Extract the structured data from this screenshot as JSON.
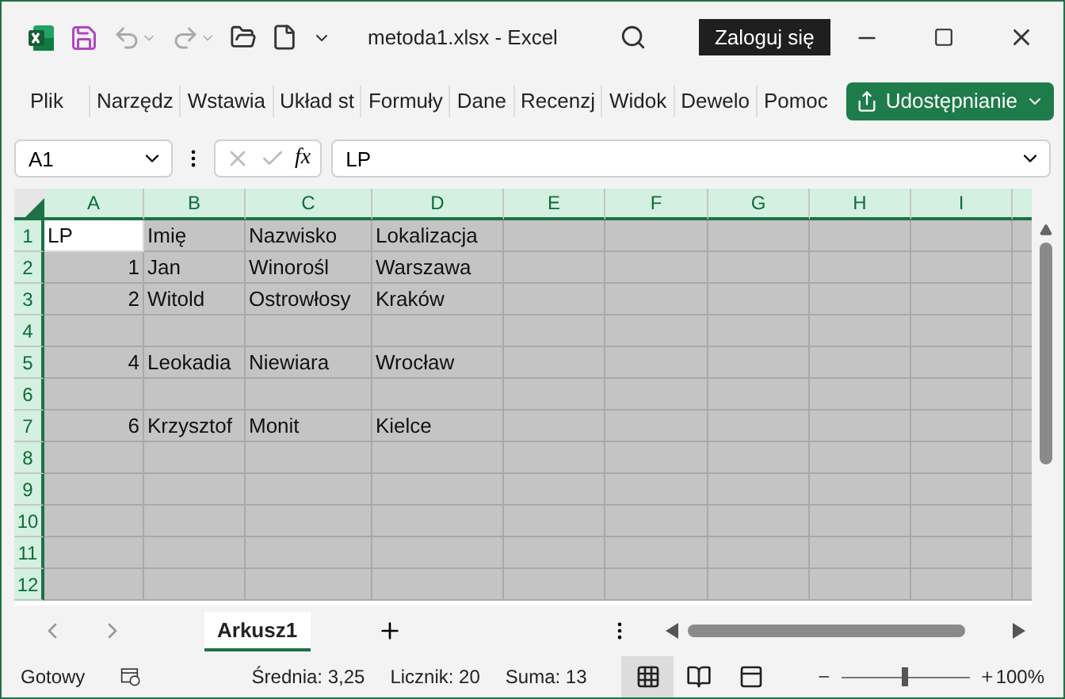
{
  "window": {
    "title": "metoda1.xlsx  -  Excel",
    "sign_in": "Zaloguj się"
  },
  "ribbon": {
    "tabs": [
      "Plik",
      "Narzędz",
      "Wstawia",
      "Układ st",
      "Formuły",
      "Dane",
      "Recenzj",
      "Widok",
      "Dewelo",
      "Pomoc"
    ],
    "share": "Udostępnianie"
  },
  "formula_bar": {
    "name_box": "A1",
    "value": "LP",
    "fx": "fx"
  },
  "grid": {
    "columns": [
      {
        "label": "A",
        "selected": true
      },
      {
        "label": "B",
        "selected": true
      },
      {
        "label": "C",
        "selected": true
      },
      {
        "label": "D",
        "selected": true
      },
      {
        "label": "E",
        "selected": true
      },
      {
        "label": "F",
        "selected": true
      },
      {
        "label": "G",
        "selected": true
      },
      {
        "label": "H",
        "selected": true
      },
      {
        "label": "I",
        "selected": true
      }
    ],
    "rows": [
      {
        "number": "1",
        "selected": true,
        "cells": [
          {
            "text": "LP",
            "kind": "text",
            "active": true
          },
          {
            "text": "Imię",
            "kind": "text"
          },
          {
            "text": "Nazwisko",
            "kind": "text"
          },
          {
            "text": "Lokalizacja",
            "kind": "text"
          }
        ]
      },
      {
        "number": "2",
        "selected": true,
        "cells": [
          {
            "text": "1",
            "kind": "number"
          },
          {
            "text": "Jan",
            "kind": "text"
          },
          {
            "text": "Winorośl",
            "kind": "text"
          },
          {
            "text": "Warszawa",
            "kind": "text"
          }
        ]
      },
      {
        "number": "3",
        "selected": true,
        "cells": [
          {
            "text": "2",
            "kind": "number"
          },
          {
            "text": "Witold",
            "kind": "text"
          },
          {
            "text": "Ostrowłosy",
            "kind": "text"
          },
          {
            "text": "Kraków",
            "kind": "text"
          }
        ]
      },
      {
        "number": "4",
        "selected": true,
        "cells": []
      },
      {
        "number": "5",
        "selected": true,
        "cells": [
          {
            "text": "4",
            "kind": "number"
          },
          {
            "text": "Leokadia",
            "kind": "text"
          },
          {
            "text": "Niewiara",
            "kind": "text"
          },
          {
            "text": "Wrocław",
            "kind": "text"
          }
        ]
      },
      {
        "number": "6",
        "selected": true,
        "cells": []
      },
      {
        "number": "7",
        "selected": true,
        "cells": [
          {
            "text": "6",
            "kind": "number"
          },
          {
            "text": "Krzysztof",
            "kind": "text"
          },
          {
            "text": "Monit",
            "kind": "text"
          },
          {
            "text": "Kielce",
            "kind": "text"
          }
        ]
      },
      {
        "number": "8",
        "selected": true,
        "cells": []
      },
      {
        "number": "9",
        "selected": true,
        "cells": []
      },
      {
        "number": "10",
        "selected": true,
        "cells": []
      },
      {
        "number": "11",
        "selected": true,
        "cells": []
      },
      {
        "number": "12",
        "selected": true,
        "cells": []
      }
    ]
  },
  "sheets": [
    {
      "label": "Arkusz1",
      "selected": true
    }
  ],
  "status_bar": {
    "mode": "Gotowy",
    "average": "Średnia: 3,25",
    "count": "Licznik: 20",
    "sum": "Suma: 13",
    "views": [
      {
        "kind": "normal",
        "selected": true
      },
      {
        "kind": "page-layout",
        "selected": false
      },
      {
        "kind": "page-break",
        "selected": false
      }
    ],
    "zoom": {
      "level": 0.5,
      "reading": "100%"
    }
  }
}
